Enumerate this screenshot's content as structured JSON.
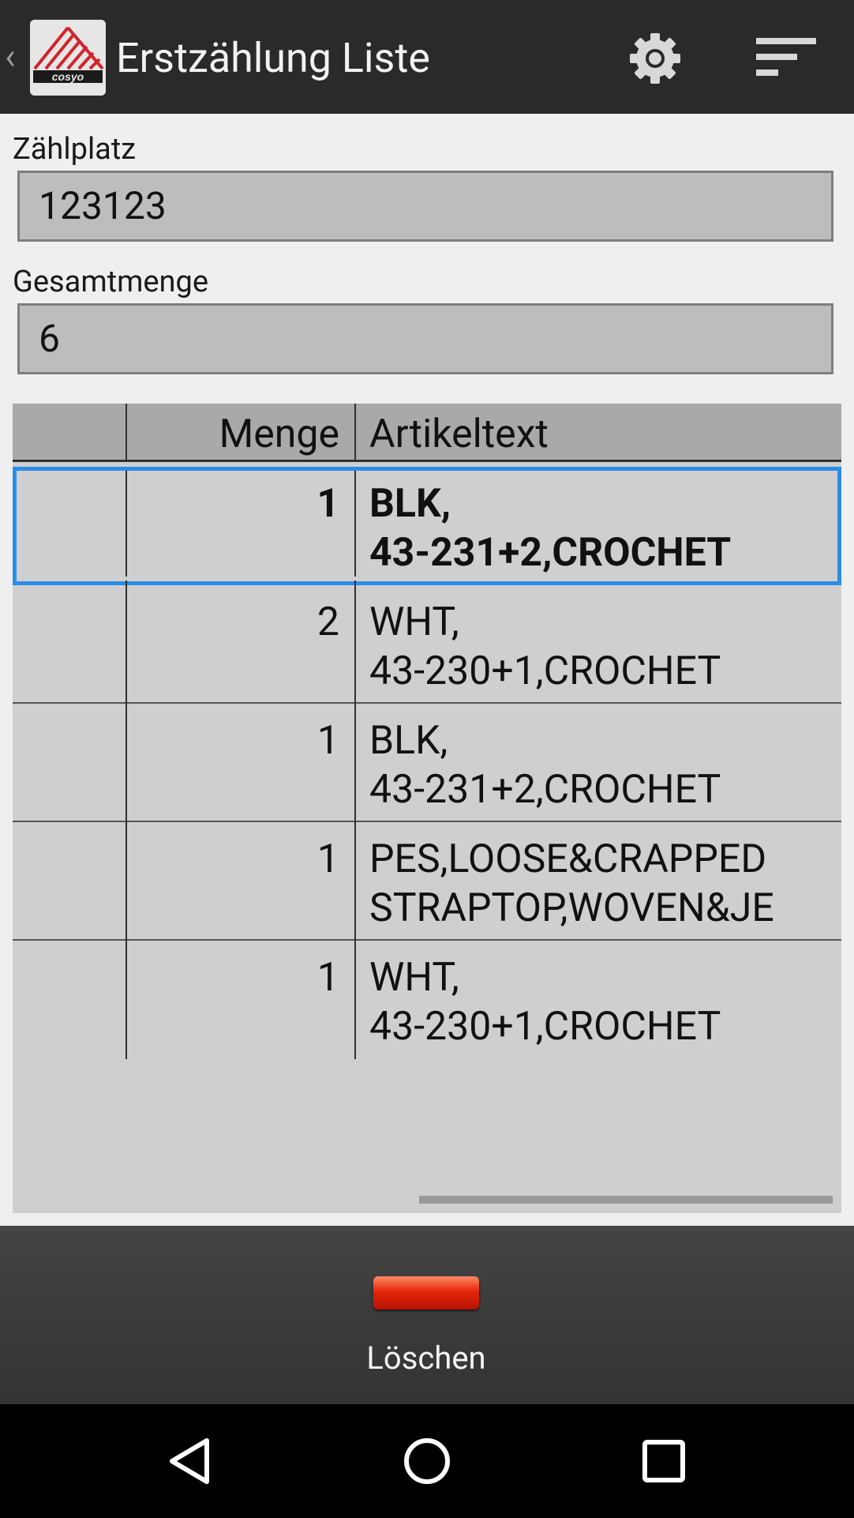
{
  "header": {
    "back_glyph": "‹",
    "title": "Erstzählung Liste",
    "logo_icon": "cosyo-logo-icon",
    "settings_icon": "gear-icon",
    "menu_icon": "sort-menu-icon"
  },
  "form": {
    "zaehlplatz_label": "Zählplatz",
    "zaehlplatz_value": "123123",
    "gesamtmenge_label": "Gesamtmenge",
    "gesamtmenge_value": "6"
  },
  "grid": {
    "columns": [
      "",
      "Menge",
      "Artikeltext"
    ],
    "selected_index": 0,
    "rows": [
      {
        "menge": "1",
        "artikeltext": "BLK,\n43-231+2,CROCHET"
      },
      {
        "menge": "2",
        "artikeltext": "WHT,\n43-230+1,CROCHET"
      },
      {
        "menge": "1",
        "artikeltext": "BLK,\n43-231+2,CROCHET"
      },
      {
        "menge": "1",
        "artikeltext": "PES,LOOSE&CRAPPED\nSTRAPTOP,WOVEN&JE"
      },
      {
        "menge": "1",
        "artikeltext": "WHT,\n43-230+1,CROCHET"
      }
    ]
  },
  "actions": {
    "delete_label": "Löschen",
    "delete_icon": "delete-bar-icon"
  },
  "navbar": {
    "back_icon": "nav-back-icon",
    "home_icon": "nav-home-icon",
    "recents_icon": "nav-recents-icon"
  },
  "colors": {
    "selection": "#2b8de8",
    "delete_red": "#e4270c"
  }
}
